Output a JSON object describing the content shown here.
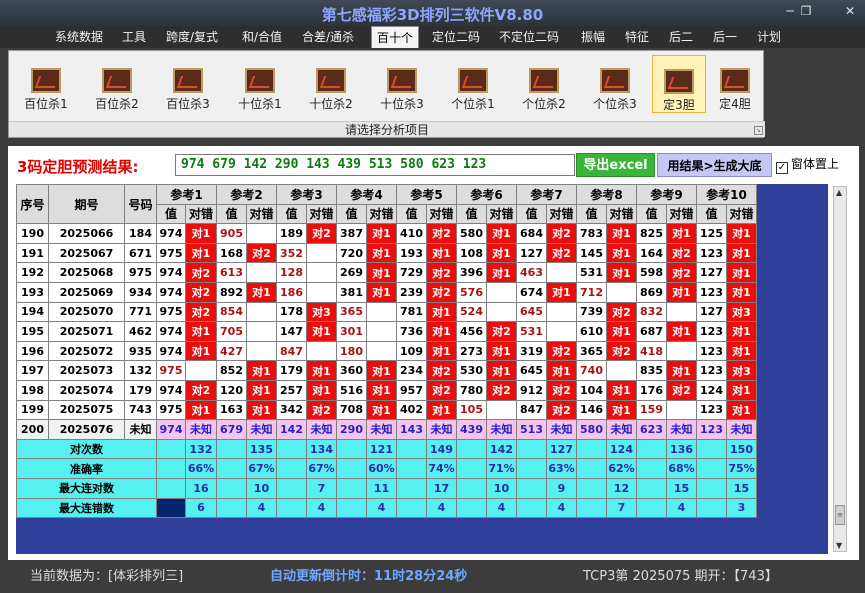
{
  "window": {
    "title": "第七感福彩3D排列三软件V8.80"
  },
  "menu": [
    "系统数据",
    "工具",
    "跨度/复式",
    "和/合值",
    "合差/通杀",
    "百十个",
    "定位二码",
    "不定位二码",
    "振幅",
    "特征",
    "后二",
    "后一",
    "计划"
  ],
  "menu_active": 5,
  "ribbon": {
    "buttons": [
      "百位杀1",
      "百位杀2",
      "百位杀3",
      "十位杀1",
      "十位杀2",
      "十位杀3",
      "个位杀1",
      "个位杀2",
      "个位杀3",
      "定3胆",
      "定4胆"
    ],
    "selected": 9,
    "caption": "请选择分析项目"
  },
  "result": {
    "label": "3码定胆预测结果:",
    "value": "974 679 142 290 143 439 513 580 623 123",
    "export_label": "导出excel",
    "generate_label": "用结果>生成大底",
    "topmost_label": "窗体置上",
    "topmost_checked": true
  },
  "table": {
    "headers": {
      "seq": "序号",
      "period": "期号",
      "code": "号码",
      "val": "值",
      "hit": "对错"
    },
    "refs": [
      "参考1",
      "参考2",
      "参考3",
      "参考4",
      "参考5",
      "参考6",
      "参考7",
      "参考8",
      "参考9",
      "参考10"
    ],
    "rows": [
      {
        "seq": "190",
        "period": "2025066",
        "code": "184",
        "cells": [
          [
            "974",
            "w"
          ],
          [
            "对1",
            "r"
          ],
          [
            "905",
            "dr"
          ],
          [
            "",
            "w"
          ],
          [
            "189",
            "w"
          ],
          [
            "对2",
            "r"
          ],
          [
            "387",
            "w"
          ],
          [
            "对1",
            "r"
          ],
          [
            "410",
            "w"
          ],
          [
            "对2",
            "r"
          ],
          [
            "580",
            "w"
          ],
          [
            "对1",
            "r"
          ],
          [
            "684",
            "w"
          ],
          [
            "对2",
            "r"
          ],
          [
            "783",
            "w"
          ],
          [
            "对1",
            "r"
          ],
          [
            "825",
            "w"
          ],
          [
            "对1",
            "r"
          ],
          [
            "125",
            "w"
          ],
          [
            "对1",
            "r"
          ]
        ]
      },
      {
        "seq": "191",
        "period": "2025067",
        "code": "671",
        "cells": [
          [
            "975",
            "w"
          ],
          [
            "对1",
            "r"
          ],
          [
            "168",
            "w"
          ],
          [
            "对2",
            "r"
          ],
          [
            "352",
            "dr"
          ],
          [
            "",
            "w"
          ],
          [
            "720",
            "w"
          ],
          [
            "对1",
            "r"
          ],
          [
            "193",
            "w"
          ],
          [
            "对1",
            "r"
          ],
          [
            "108",
            "w"
          ],
          [
            "对1",
            "r"
          ],
          [
            "127",
            "w"
          ],
          [
            "对2",
            "r"
          ],
          [
            "145",
            "w"
          ],
          [
            "对1",
            "r"
          ],
          [
            "164",
            "w"
          ],
          [
            "对2",
            "r"
          ],
          [
            "123",
            "w"
          ],
          [
            "对1",
            "r"
          ]
        ]
      },
      {
        "seq": "192",
        "period": "2025068",
        "code": "975",
        "cells": [
          [
            "974",
            "w"
          ],
          [
            "对2",
            "r"
          ],
          [
            "613",
            "dr"
          ],
          [
            "",
            "w"
          ],
          [
            "128",
            "dr"
          ],
          [
            "",
            "w"
          ],
          [
            "269",
            "w"
          ],
          [
            "对1",
            "r"
          ],
          [
            "729",
            "w"
          ],
          [
            "对2",
            "r"
          ],
          [
            "396",
            "w"
          ],
          [
            "对1",
            "r"
          ],
          [
            "463",
            "dr"
          ],
          [
            "",
            "w"
          ],
          [
            "531",
            "w"
          ],
          [
            "对1",
            "r"
          ],
          [
            "598",
            "w"
          ],
          [
            "对2",
            "r"
          ],
          [
            "127",
            "w"
          ],
          [
            "对1",
            "r"
          ]
        ]
      },
      {
        "seq": "193",
        "period": "2025069",
        "code": "934",
        "cells": [
          [
            "974",
            "w"
          ],
          [
            "对2",
            "r"
          ],
          [
            "892",
            "w"
          ],
          [
            "对1",
            "r"
          ],
          [
            "186",
            "dr"
          ],
          [
            "",
            "w"
          ],
          [
            "381",
            "w"
          ],
          [
            "对1",
            "r"
          ],
          [
            "239",
            "w"
          ],
          [
            "对2",
            "r"
          ],
          [
            "576",
            "dr"
          ],
          [
            "",
            "w"
          ],
          [
            "674",
            "w"
          ],
          [
            "对1",
            "r"
          ],
          [
            "712",
            "dr"
          ],
          [
            "",
            "w"
          ],
          [
            "869",
            "w"
          ],
          [
            "对1",
            "r"
          ],
          [
            "123",
            "w"
          ],
          [
            "对1",
            "r"
          ]
        ]
      },
      {
        "seq": "194",
        "period": "2025070",
        "code": "771",
        "cells": [
          [
            "975",
            "w"
          ],
          [
            "对2",
            "r"
          ],
          [
            "854",
            "dr"
          ],
          [
            "",
            "w"
          ],
          [
            "178",
            "w"
          ],
          [
            "对3",
            "r"
          ],
          [
            "365",
            "dr"
          ],
          [
            "",
            "w"
          ],
          [
            "781",
            "w"
          ],
          [
            "对1",
            "r"
          ],
          [
            "524",
            "dr"
          ],
          [
            "",
            "w"
          ],
          [
            "645",
            "dr"
          ],
          [
            "",
            "w"
          ],
          [
            "739",
            "w"
          ],
          [
            "对2",
            "r"
          ],
          [
            "832",
            "dr"
          ],
          [
            "",
            "w"
          ],
          [
            "127",
            "w"
          ],
          [
            "对3",
            "r"
          ]
        ]
      },
      {
        "seq": "195",
        "period": "2025071",
        "code": "462",
        "cells": [
          [
            "974",
            "w"
          ],
          [
            "对1",
            "r"
          ],
          [
            "705",
            "dr"
          ],
          [
            "",
            "w"
          ],
          [
            "147",
            "w"
          ],
          [
            "对1",
            "r"
          ],
          [
            "301",
            "dr"
          ],
          [
            "",
            "w"
          ],
          [
            "736",
            "w"
          ],
          [
            "对1",
            "r"
          ],
          [
            "456",
            "w"
          ],
          [
            "对2",
            "r"
          ],
          [
            "531",
            "dr"
          ],
          [
            "",
            "w"
          ],
          [
            "610",
            "w"
          ],
          [
            "对1",
            "r"
          ],
          [
            "687",
            "w"
          ],
          [
            "对1",
            "r"
          ],
          [
            "123",
            "w"
          ],
          [
            "对1",
            "r"
          ]
        ]
      },
      {
        "seq": "196",
        "period": "2025072",
        "code": "935",
        "cells": [
          [
            "974",
            "w"
          ],
          [
            "对1",
            "r"
          ],
          [
            "427",
            "dr"
          ],
          [
            "",
            "w"
          ],
          [
            "847",
            "dr"
          ],
          [
            "",
            "w"
          ],
          [
            "180",
            "dr"
          ],
          [
            "",
            "w"
          ],
          [
            "109",
            "w"
          ],
          [
            "对1",
            "r"
          ],
          [
            "273",
            "w"
          ],
          [
            "对1",
            "r"
          ],
          [
            "319",
            "w"
          ],
          [
            "对2",
            "r"
          ],
          [
            "365",
            "w"
          ],
          [
            "对2",
            "r"
          ],
          [
            "418",
            "dr"
          ],
          [
            "",
            "w"
          ],
          [
            "123",
            "w"
          ],
          [
            "对1",
            "r"
          ]
        ]
      },
      {
        "seq": "197",
        "period": "2025073",
        "code": "132",
        "cells": [
          [
            "975",
            "dr"
          ],
          [
            "",
            "w"
          ],
          [
            "852",
            "w"
          ],
          [
            "对1",
            "r"
          ],
          [
            "179",
            "w"
          ],
          [
            "对1",
            "r"
          ],
          [
            "360",
            "w"
          ],
          [
            "对1",
            "r"
          ],
          [
            "234",
            "w"
          ],
          [
            "对2",
            "r"
          ],
          [
            "530",
            "w"
          ],
          [
            "对1",
            "r"
          ],
          [
            "645",
            "w"
          ],
          [
            "对1",
            "r"
          ],
          [
            "740",
            "dr"
          ],
          [
            "",
            "w"
          ],
          [
            "835",
            "w"
          ],
          [
            "对1",
            "r"
          ],
          [
            "123",
            "w"
          ],
          [
            "对3",
            "r"
          ]
        ]
      },
      {
        "seq": "198",
        "period": "2025074",
        "code": "179",
        "cells": [
          [
            "974",
            "w"
          ],
          [
            "对2",
            "r"
          ],
          [
            "120",
            "w"
          ],
          [
            "对1",
            "r"
          ],
          [
            "257",
            "w"
          ],
          [
            "对1",
            "r"
          ],
          [
            "516",
            "w"
          ],
          [
            "对1",
            "r"
          ],
          [
            "957",
            "w"
          ],
          [
            "对2",
            "r"
          ],
          [
            "780",
            "w"
          ],
          [
            "对2",
            "r"
          ],
          [
            "912",
            "w"
          ],
          [
            "对2",
            "r"
          ],
          [
            "104",
            "w"
          ],
          [
            "对1",
            "r"
          ],
          [
            "176",
            "w"
          ],
          [
            "对2",
            "r"
          ],
          [
            "124",
            "w"
          ],
          [
            "对1",
            "r"
          ]
        ]
      },
      {
        "seq": "199",
        "period": "2025075",
        "code": "743",
        "cells": [
          [
            "975",
            "w"
          ],
          [
            "对1",
            "r"
          ],
          [
            "163",
            "w"
          ],
          [
            "对1",
            "r"
          ],
          [
            "342",
            "w"
          ],
          [
            "对2",
            "r"
          ],
          [
            "708",
            "w"
          ],
          [
            "对1",
            "r"
          ],
          [
            "402",
            "w"
          ],
          [
            "对1",
            "r"
          ],
          [
            "105",
            "dr"
          ],
          [
            "",
            "w"
          ],
          [
            "847",
            "w"
          ],
          [
            "对2",
            "r"
          ],
          [
            "146",
            "w"
          ],
          [
            "对1",
            "r"
          ],
          [
            "159",
            "dr"
          ],
          [
            "",
            "w"
          ],
          [
            "123",
            "w"
          ],
          [
            "对1",
            "r"
          ]
        ]
      },
      {
        "seq": "200",
        "period": "2025076",
        "code": "未知",
        "cells": [
          [
            "974",
            "p"
          ],
          [
            "未知",
            "p"
          ],
          [
            "679",
            "p"
          ],
          [
            "未知",
            "p"
          ],
          [
            "142",
            "p"
          ],
          [
            "未知",
            "p"
          ],
          [
            "290",
            "p"
          ],
          [
            "未知",
            "p"
          ],
          [
            "143",
            "p"
          ],
          [
            "未知",
            "p"
          ],
          [
            "439",
            "p"
          ],
          [
            "未知",
            "p"
          ],
          [
            "513",
            "p"
          ],
          [
            "未知",
            "p"
          ],
          [
            "580",
            "p"
          ],
          [
            "未知",
            "p"
          ],
          [
            "623",
            "p"
          ],
          [
            "未知",
            "p"
          ],
          [
            "123",
            "p"
          ],
          [
            "未知",
            "p"
          ]
        ]
      }
    ],
    "stats": [
      {
        "label": "对次数",
        "values": [
          "132",
          "135",
          "134",
          "121",
          "149",
          "142",
          "127",
          "124",
          "136",
          "150"
        ]
      },
      {
        "label": "准确率",
        "values": [
          "66%",
          "67%",
          "67%",
          "60%",
          "74%",
          "71%",
          "63%",
          "62%",
          "68%",
          "75%"
        ]
      },
      {
        "label": "最大连对数",
        "values": [
          "16",
          "10",
          "7",
          "11",
          "17",
          "10",
          "9",
          "12",
          "15",
          "15"
        ]
      },
      {
        "label": "最大连错数",
        "values": [
          "6",
          "4",
          "4",
          "4",
          "4",
          "4",
          "4",
          "7",
          "4",
          "3"
        ]
      }
    ]
  },
  "status": {
    "current_data": "当前数据为：[体彩排列三]",
    "countdown_label": "自动更新倒计时：",
    "countdown": "11时28分24秒",
    "period_info": "TCP3第 2025075 期开：【743】"
  }
}
